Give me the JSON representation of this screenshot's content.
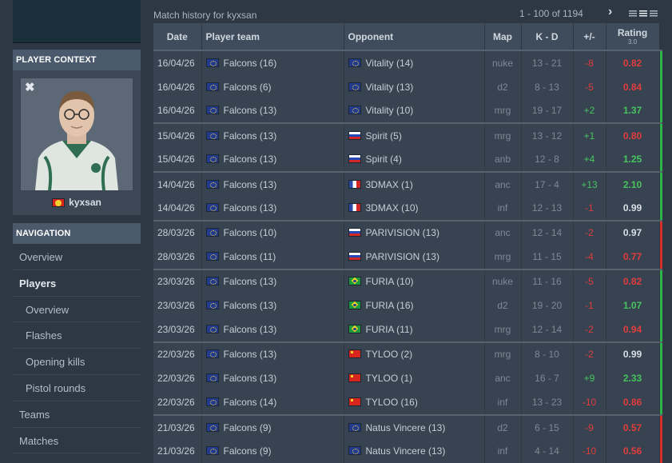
{
  "sidebar": {
    "player_context_title": "PLAYER CONTEXT",
    "close_label": "✖",
    "player_name": "kyxsan",
    "player_flag": "mk",
    "navigation_title": "NAVIGATION",
    "nav_items": [
      {
        "label": "Overview"
      },
      {
        "label": "Players"
      },
      {
        "label": "Overview"
      },
      {
        "label": "Flashes"
      },
      {
        "label": "Opening kills"
      },
      {
        "label": "Pistol rounds"
      },
      {
        "label": "Teams"
      },
      {
        "label": "Matches"
      }
    ]
  },
  "main": {
    "title": "Match history for kyxsan",
    "pagination": "1 - 100 of 1194",
    "next_icon": "›",
    "columns": {
      "date": "Date",
      "player_team": "Player team",
      "opponent": "Opponent",
      "map": "Map",
      "kd": "K - D",
      "diff": "+/-",
      "rating": "Rating",
      "rating_version": "3.0"
    },
    "rows": [
      {
        "date": "16/04/26",
        "team": "Falcons (16)",
        "team_flag": "eu",
        "opponent": "Vitality (14)",
        "opp_flag": "eu",
        "map": "nuke",
        "kd": "13 - 21",
        "diff": "-8",
        "rating": "0.82",
        "group_start": true,
        "result": "win"
      },
      {
        "date": "16/04/26",
        "team": "Falcons (6)",
        "team_flag": "eu",
        "opponent": "Vitality (13)",
        "opp_flag": "eu",
        "map": "d2",
        "kd": "8 - 13",
        "diff": "-5",
        "rating": "0.84",
        "group_start": false,
        "result": "win"
      },
      {
        "date": "16/04/26",
        "team": "Falcons (13)",
        "team_flag": "eu",
        "opponent": "Vitality (10)",
        "opp_flag": "eu",
        "map": "mrg",
        "kd": "19 - 17",
        "diff": "+2",
        "rating": "1.37",
        "group_start": false,
        "result": "win"
      },
      {
        "date": "15/04/26",
        "team": "Falcons (13)",
        "team_flag": "eu",
        "opponent": "Spirit (5)",
        "opp_flag": "ru",
        "map": "mrg",
        "kd": "13 - 12",
        "diff": "+1",
        "rating": "0.80",
        "group_start": true,
        "result": "win"
      },
      {
        "date": "15/04/26",
        "team": "Falcons (13)",
        "team_flag": "eu",
        "opponent": "Spirit (4)",
        "opp_flag": "ru",
        "map": "anb",
        "kd": "12 - 8",
        "diff": "+4",
        "rating": "1.25",
        "group_start": false,
        "result": "win"
      },
      {
        "date": "14/04/26",
        "team": "Falcons (13)",
        "team_flag": "eu",
        "opponent": "3DMAX (1)",
        "opp_flag": "fr",
        "map": "anc",
        "kd": "17 - 4",
        "diff": "+13",
        "rating": "2.10",
        "group_start": true,
        "result": "win"
      },
      {
        "date": "14/04/26",
        "team": "Falcons (13)",
        "team_flag": "eu",
        "opponent": "3DMAX (10)",
        "opp_flag": "fr",
        "map": "inf",
        "kd": "12 - 13",
        "diff": "-1",
        "rating": "0.99",
        "group_start": false,
        "result": "win"
      },
      {
        "date": "28/03/26",
        "team": "Falcons (10)",
        "team_flag": "eu",
        "opponent": "PARIVISION (13)",
        "opp_flag": "ru",
        "map": "anc",
        "kd": "12 - 14",
        "diff": "-2",
        "rating": "0.97",
        "group_start": true,
        "result": "loss"
      },
      {
        "date": "28/03/26",
        "team": "Falcons (11)",
        "team_flag": "eu",
        "opponent": "PARIVISION (13)",
        "opp_flag": "ru",
        "map": "mrg",
        "kd": "11 - 15",
        "diff": "-4",
        "rating": "0.77",
        "group_start": false,
        "result": "loss"
      },
      {
        "date": "23/03/26",
        "team": "Falcons (13)",
        "team_flag": "eu",
        "opponent": "FURIA (10)",
        "opp_flag": "br",
        "map": "nuke",
        "kd": "11 - 16",
        "diff": "-5",
        "rating": "0.82",
        "group_start": true,
        "result": "win"
      },
      {
        "date": "23/03/26",
        "team": "Falcons (13)",
        "team_flag": "eu",
        "opponent": "FURIA (16)",
        "opp_flag": "br",
        "map": "d2",
        "kd": "19 - 20",
        "diff": "-1",
        "rating": "1.07",
        "group_start": false,
        "result": "win"
      },
      {
        "date": "23/03/26",
        "team": "Falcons (13)",
        "team_flag": "eu",
        "opponent": "FURIA (11)",
        "opp_flag": "br",
        "map": "mrg",
        "kd": "12 - 14",
        "diff": "-2",
        "rating": "0.94",
        "group_start": false,
        "result": "win"
      },
      {
        "date": "22/03/26",
        "team": "Falcons (13)",
        "team_flag": "eu",
        "opponent": "TYLOO (2)",
        "opp_flag": "cn",
        "map": "mrg",
        "kd": "8 - 10",
        "diff": "-2",
        "rating": "0.99",
        "group_start": true,
        "result": "win"
      },
      {
        "date": "22/03/26",
        "team": "Falcons (13)",
        "team_flag": "eu",
        "opponent": "TYLOO (1)",
        "opp_flag": "cn",
        "map": "anc",
        "kd": "16 - 7",
        "diff": "+9",
        "rating": "2.33",
        "group_start": false,
        "result": "win"
      },
      {
        "date": "22/03/26",
        "team": "Falcons (14)",
        "team_flag": "eu",
        "opponent": "TYLOO (16)",
        "opp_flag": "cn",
        "map": "inf",
        "kd": "13 - 23",
        "diff": "-10",
        "rating": "0.86",
        "group_start": false,
        "result": "win"
      },
      {
        "date": "21/03/26",
        "team": "Falcons (9)",
        "team_flag": "eu",
        "opponent": "Natus Vincere (13)",
        "opp_flag": "eu",
        "map": "d2",
        "kd": "6 - 15",
        "diff": "-9",
        "rating": "0.57",
        "group_start": true,
        "result": "loss"
      },
      {
        "date": "21/03/26",
        "team": "Falcons (9)",
        "team_flag": "eu",
        "opponent": "Natus Vincere (13)",
        "opp_flag": "eu",
        "map": "inf",
        "kd": "4 - 14",
        "diff": "-10",
        "rating": "0.56",
        "group_start": false,
        "result": "loss"
      }
    ]
  }
}
